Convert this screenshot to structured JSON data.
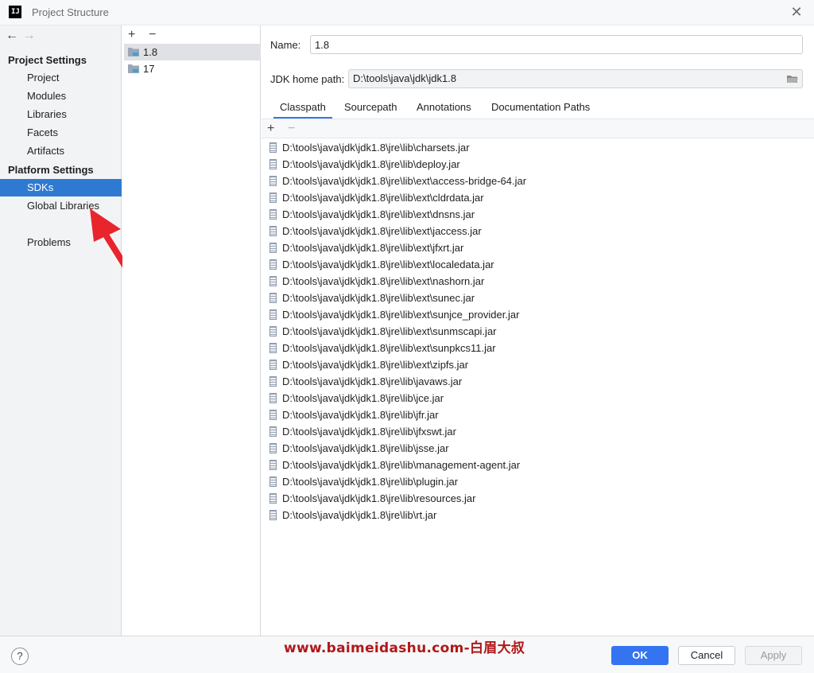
{
  "window": {
    "title": "Project Structure",
    "logo_text": "IJ",
    "close": "✕"
  },
  "nav": {
    "back": "←",
    "forward": "→"
  },
  "sidebar": {
    "project_settings_header": "Project Settings",
    "project_items": [
      "Project",
      "Modules",
      "Libraries",
      "Facets",
      "Artifacts"
    ],
    "platform_settings_header": "Platform Settings",
    "platform_items": [
      "SDKs",
      "Global Libraries"
    ],
    "problems": "Problems",
    "selected": "SDKs"
  },
  "sdk_list": {
    "add": "+",
    "remove": "−",
    "items": [
      "1.8",
      "17"
    ],
    "selected": "1.8"
  },
  "detail": {
    "name_label": "Name:",
    "name_value": "1.8",
    "home_label": "JDK home path:",
    "home_value": "D:\\tools\\java\\jdk\\jdk1.8",
    "tabs": [
      "Classpath",
      "Sourcepath",
      "Annotations",
      "Documentation Paths"
    ],
    "active_tab": "Classpath",
    "paths_add": "+",
    "paths_remove": "−",
    "classpath": [
      "D:\\tools\\java\\jdk\\jdk1.8\\jre\\lib\\charsets.jar",
      "D:\\tools\\java\\jdk\\jdk1.8\\jre\\lib\\deploy.jar",
      "D:\\tools\\java\\jdk\\jdk1.8\\jre\\lib\\ext\\access-bridge-64.jar",
      "D:\\tools\\java\\jdk\\jdk1.8\\jre\\lib\\ext\\cldrdata.jar",
      "D:\\tools\\java\\jdk\\jdk1.8\\jre\\lib\\ext\\dnsns.jar",
      "D:\\tools\\java\\jdk\\jdk1.8\\jre\\lib\\ext\\jaccess.jar",
      "D:\\tools\\java\\jdk\\jdk1.8\\jre\\lib\\ext\\jfxrt.jar",
      "D:\\tools\\java\\jdk\\jdk1.8\\jre\\lib\\ext\\localedata.jar",
      "D:\\tools\\java\\jdk\\jdk1.8\\jre\\lib\\ext\\nashorn.jar",
      "D:\\tools\\java\\jdk\\jdk1.8\\jre\\lib\\ext\\sunec.jar",
      "D:\\tools\\java\\jdk\\jdk1.8\\jre\\lib\\ext\\sunjce_provider.jar",
      "D:\\tools\\java\\jdk\\jdk1.8\\jre\\lib\\ext\\sunmscapi.jar",
      "D:\\tools\\java\\jdk\\jdk1.8\\jre\\lib\\ext\\sunpkcs11.jar",
      "D:\\tools\\java\\jdk\\jdk1.8\\jre\\lib\\ext\\zipfs.jar",
      "D:\\tools\\java\\jdk\\jdk1.8\\jre\\lib\\javaws.jar",
      "D:\\tools\\java\\jdk\\jdk1.8\\jre\\lib\\jce.jar",
      "D:\\tools\\java\\jdk\\jdk1.8\\jre\\lib\\jfr.jar",
      "D:\\tools\\java\\jdk\\jdk1.8\\jre\\lib\\jfxswt.jar",
      "D:\\tools\\java\\jdk\\jdk1.8\\jre\\lib\\jsse.jar",
      "D:\\tools\\java\\jdk\\jdk1.8\\jre\\lib\\management-agent.jar",
      "D:\\tools\\java\\jdk\\jdk1.8\\jre\\lib\\plugin.jar",
      "D:\\tools\\java\\jdk\\jdk1.8\\jre\\lib\\resources.jar",
      "D:\\tools\\java\\jdk\\jdk1.8\\jre\\lib\\rt.jar"
    ]
  },
  "footer": {
    "help": "?",
    "watermark": "www.baimeidashu.com-白眉大叔",
    "ok": "OK",
    "cancel": "Cancel",
    "apply": "Apply"
  },
  "colors": {
    "accent": "#3574f0",
    "selection": "#2f7ad1",
    "annotation_arrow": "#e8242c",
    "watermark": "#b01818"
  }
}
